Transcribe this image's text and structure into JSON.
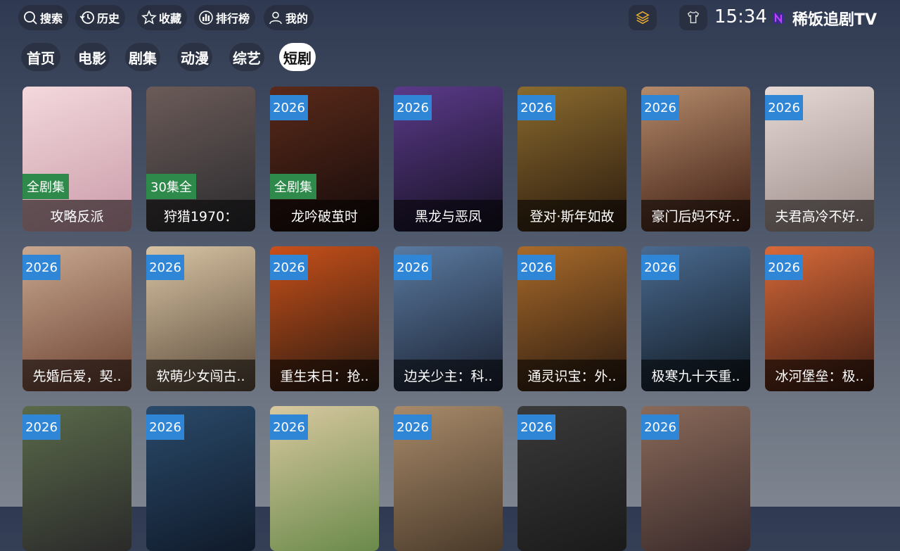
{
  "header": {
    "nav": [
      {
        "label": "搜索",
        "icon": "search-icon"
      },
      {
        "label": "历史",
        "icon": "history-icon"
      },
      {
        "label": "收藏",
        "icon": "star-icon"
      },
      {
        "label": "排行榜",
        "icon": "ranking-icon"
      },
      {
        "label": "我的",
        "icon": "user-icon"
      }
    ],
    "layers_icon": "layers-icon",
    "skin_icon": "tshirt-icon",
    "time": "15:34",
    "app_name": "稀饭追剧TV"
  },
  "tabs": [
    "首页",
    "电影",
    "剧集",
    "动漫",
    "综艺",
    "短剧"
  ],
  "active_tab": "短剧",
  "rows": [
    [
      {
        "title": "攻略反派",
        "year": "",
        "badge": "全剧集",
        "c1": "#f3d8dc",
        "c2": "#c99aa8"
      },
      {
        "title": "狩猎1970：",
        "year": "",
        "badge": "30集全",
        "c1": "#6b5b58",
        "c2": "#2a2a2e"
      },
      {
        "title": "龙吟破茧时",
        "year": "2026",
        "badge": "全剧集",
        "c1": "#5a2a1a",
        "c2": "#140a0a"
      },
      {
        "title": "黑龙与恶凤",
        "year": "2026",
        "badge": "",
        "c1": "#5b3a8a",
        "c2": "#141020"
      },
      {
        "title": "登对·斯年如故",
        "year": "2026",
        "badge": "",
        "c1": "#8a6a2e",
        "c2": "#2a1a0e"
      },
      {
        "title": "豪门后妈不好..",
        "year": "2026",
        "badge": "",
        "c1": "#b48a6a",
        "c2": "#3a1a10"
      },
      {
        "title": "夫君高冷不好..",
        "year": "2026",
        "badge": "",
        "c1": "#e6dad6",
        "c2": "#9a8a86"
      }
    ],
    [
      {
        "title": "先婚后爱，契..",
        "year": "2026",
        "badge": "",
        "c1": "#c8a890",
        "c2": "#6a4030"
      },
      {
        "title": "软萌少女闯古..",
        "year": "2026",
        "badge": "",
        "c1": "#d8c4a4",
        "c2": "#5a4a3a"
      },
      {
        "title": "重生末日：抢..",
        "year": "2026",
        "badge": "",
        "c1": "#c8501a",
        "c2": "#2a1a10"
      },
      {
        "title": "边关少主：科..",
        "year": "2026",
        "badge": "",
        "c1": "#5a7aa0",
        "c2": "#1a2030"
      },
      {
        "title": "通灵识宝：外..",
        "year": "2026",
        "badge": "",
        "c1": "#a86a2a",
        "c2": "#2a1a10"
      },
      {
        "title": "极寒九十天重..",
        "year": "2026",
        "badge": "",
        "c1": "#4a6a90",
        "c2": "#101820"
      },
      {
        "title": "冰河堡垒：极..",
        "year": "2026",
        "badge": "",
        "c1": "#d86a3a",
        "c2": "#3a1a10"
      }
    ],
    [
      {
        "title": "",
        "year": "2026",
        "badge": "",
        "c1": "#5a6a4a",
        "c2": "#2a2a2a"
      },
      {
        "title": "",
        "year": "2026",
        "badge": "",
        "c1": "#2a4a6a",
        "c2": "#101a2a"
      },
      {
        "title": "",
        "year": "2026",
        "badge": "",
        "c1": "#d8c8a0",
        "c2": "#6a8a4a"
      },
      {
        "title": "",
        "year": "2026",
        "badge": "",
        "c1": "#a88a6a",
        "c2": "#4a3a2a"
      },
      {
        "title": "",
        "year": "2026",
        "badge": "",
        "c1": "#3a3a3a",
        "c2": "#1a1a1a"
      },
      {
        "title": "",
        "year": "2026",
        "badge": "",
        "c1": "#8a6a5a",
        "c2": "#3a2a2a"
      }
    ]
  ]
}
